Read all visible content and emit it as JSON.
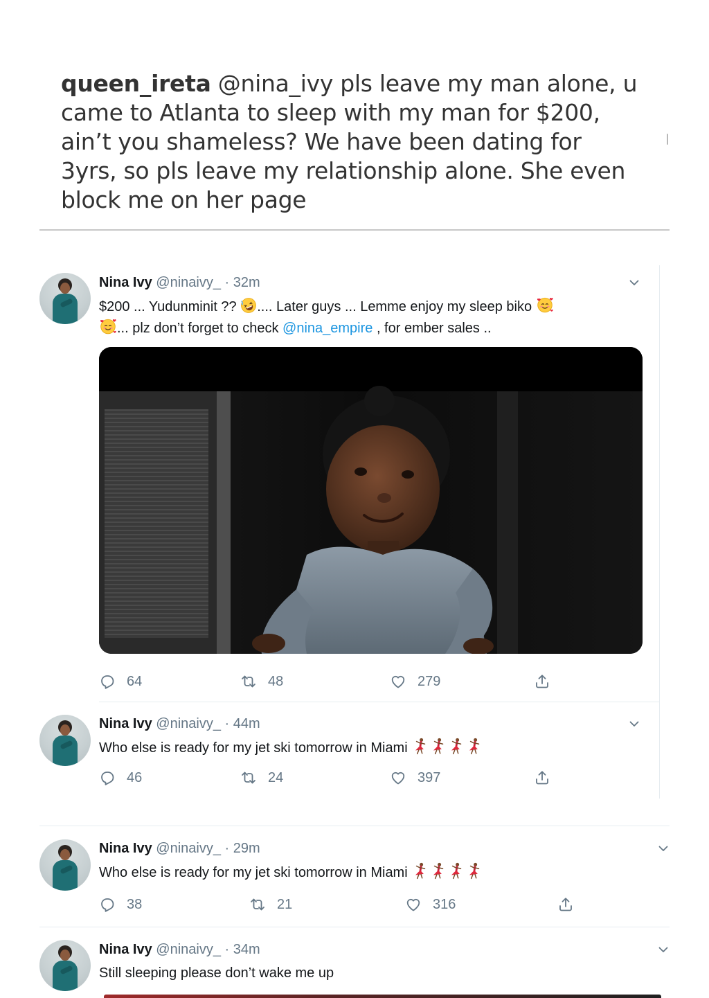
{
  "caption": {
    "username": "queen_ireta",
    "mention": "@nina_ivy",
    "lines": [
      " pls leave my man alone, u",
      "came to Atlanta to sleep with my man for $200,",
      "ain’t you shameless? We have been dating for",
      "3yrs, so pls leave my relationship alone. She even",
      "block me on her page"
    ]
  },
  "tweets": [
    {
      "name": "Nina Ivy",
      "handle": "@ninaivy_",
      "dot": "·",
      "time": "32m",
      "line1_a": "$200 ... Yudunminit ??",
      "line1_b": ".... Later guys ... Lemme enjoy my sleep biko",
      "line2_a": "... plz don’t forget to check ",
      "mention": "@nina_empire",
      "line2_b": " , for ember sales ..",
      "replies": "64",
      "retweets": "48",
      "likes": "279"
    },
    {
      "name": "Nina Ivy",
      "handle": "@ninaivy_",
      "dot": "·",
      "time": "44m",
      "text": "Who else is ready for my jet ski tomorrow in Miami",
      "replies": "46",
      "retweets": "24",
      "likes": "397"
    },
    {
      "name": "Nina Ivy",
      "handle": "@ninaivy_",
      "dot": "·",
      "time": "29m",
      "text": "Who else is ready for my jet ski tomorrow in Miami",
      "replies": "38",
      "retweets": "21",
      "likes": "316"
    },
    {
      "name": "Nina Ivy",
      "handle": "@ninaivy_",
      "dot": "·",
      "time": "34m",
      "text": "Still sleeping please don’t wake me up"
    }
  ],
  "colors": {
    "link": "#1b95e0",
    "secondary_text": "#657786",
    "separator": "#e6ecf0"
  },
  "icons": [
    "reply-icon",
    "retweet-icon",
    "like-icon",
    "share-icon",
    "chevron-down-icon",
    "rofl-emoji",
    "smiling-hearts-emoji",
    "dancer-emoji"
  ]
}
